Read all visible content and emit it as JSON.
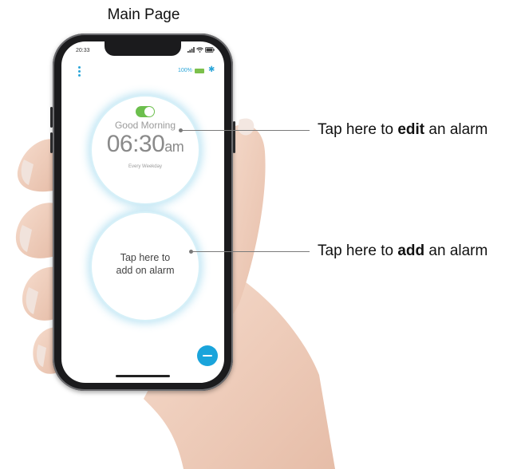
{
  "heading": "Main Page",
  "phone": {
    "status_time": "20:33",
    "battery_percent": "100%",
    "icons": {
      "menu": "vertical-dots-icon",
      "battery": "battery-icon",
      "bluetooth": "bluetooth-icon",
      "signal": "signal-icon",
      "wifi": "wifi-icon"
    },
    "alarm": {
      "enabled": true,
      "name": "Good Morning",
      "time": "06:30",
      "ampm": "am",
      "repeat": "Every Weekday"
    },
    "add_alarm_line1": "Tap here to",
    "add_alarm_line2": "add on alarm",
    "fab_icon": "minus-icon"
  },
  "callouts": {
    "edit": {
      "prefix": "Tap here to ",
      "bold": "edit",
      "suffix": " an alarm"
    },
    "add": {
      "prefix": "Tap here to ",
      "bold": "add",
      "suffix": " an alarm"
    }
  },
  "colors": {
    "accent": "#1aa4db",
    "toggle_on": "#6cbf4d",
    "battery": "#7cc04b",
    "circle_glow": "#d6f0f8"
  }
}
